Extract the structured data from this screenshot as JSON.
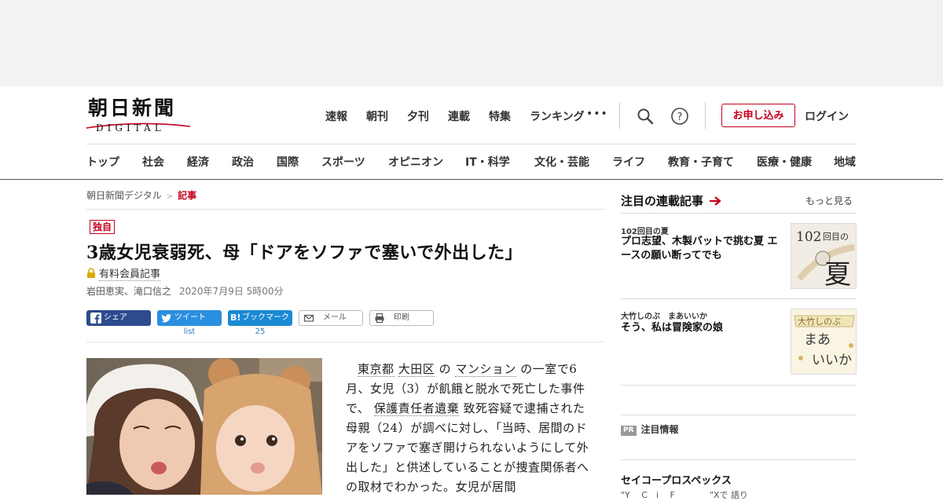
{
  "logo": {
    "main": "朝日新聞",
    "sub": "DIGITAL"
  },
  "top_nav": [
    "速報",
    "朝刊",
    "夕刊",
    "連載",
    "特集",
    "ランキング"
  ],
  "more_label": "•••",
  "signup_label": "お申し込み",
  "login_label": "ログイン",
  "category_nav": [
    "トップ",
    "社会",
    "経済",
    "政治",
    "国際",
    "スポーツ",
    "オピニオン",
    "IT・科学",
    "文化・芸能",
    "ライフ",
    "教育・子育て",
    "医療・健康",
    "地域"
  ],
  "breadcrumb": {
    "home": "朝日新聞デジタル",
    "separator": ">",
    "current": "記事"
  },
  "article": {
    "badge": "独自",
    "headline": "3歳女児衰弱死、母「ドアをソファで塞いで外出した」",
    "paid_label": "有料会員記事",
    "authors": "岩田恵実、滝口信之",
    "date": "2020年7月9日 5時00分",
    "body": {
      "kw1": "東京都",
      "kw2": "大田区",
      "t1": "の",
      "kw3": "マンション",
      "t2": "の一室で6月、女児（3）が飢餓と脱水で死亡した事件で、",
      "kw4": "保護責任者遺棄",
      "t3": "致死容疑で逮捕された母親（24）が調べに対し、「当時、居間のドアをソファで塞ぎ開けられないようにして外出した」と供述していることが捜査関係者への取材でわかった。女児が居間"
    }
  },
  "share": {
    "facebook": "シェア",
    "twitter": "ツイート",
    "twitter_count": "list",
    "hatena": "ブックマーク",
    "hatena_count": "25",
    "mail": "メール",
    "print": "印刷"
  },
  "sidebar": {
    "title": "注目の連載記事",
    "more": "もっと見る",
    "items": [
      {
        "tag": "102回目の夏",
        "title": "プロ志望、木製バットで挑む夏 エースの願い断ってでも",
        "thumb_text_1": "102",
        "thumb_text_2": "回目の",
        "thumb_text_3": "夏"
      },
      {
        "tag": "大竹しのぶ　まあいいか",
        "title": "そう、私は冒険家の娘",
        "thumb_text_1": "大竹しのぶ",
        "thumb_text_2": "まあ",
        "thumb_text_3": "いいか"
      }
    ],
    "pr_badge": "PR",
    "pr_label": "注目情報",
    "sponsor": "セイコープロスペックス",
    "sponsor_sub": "\"Y　 C　i　 F　　　　\"Xで 語り"
  },
  "colors": {
    "accent_red": "#c4001d",
    "twitter_blue": "#2a8fe0",
    "facebook_navy": "#2d4b8e",
    "hatena_blue": "#1a8ad4"
  }
}
